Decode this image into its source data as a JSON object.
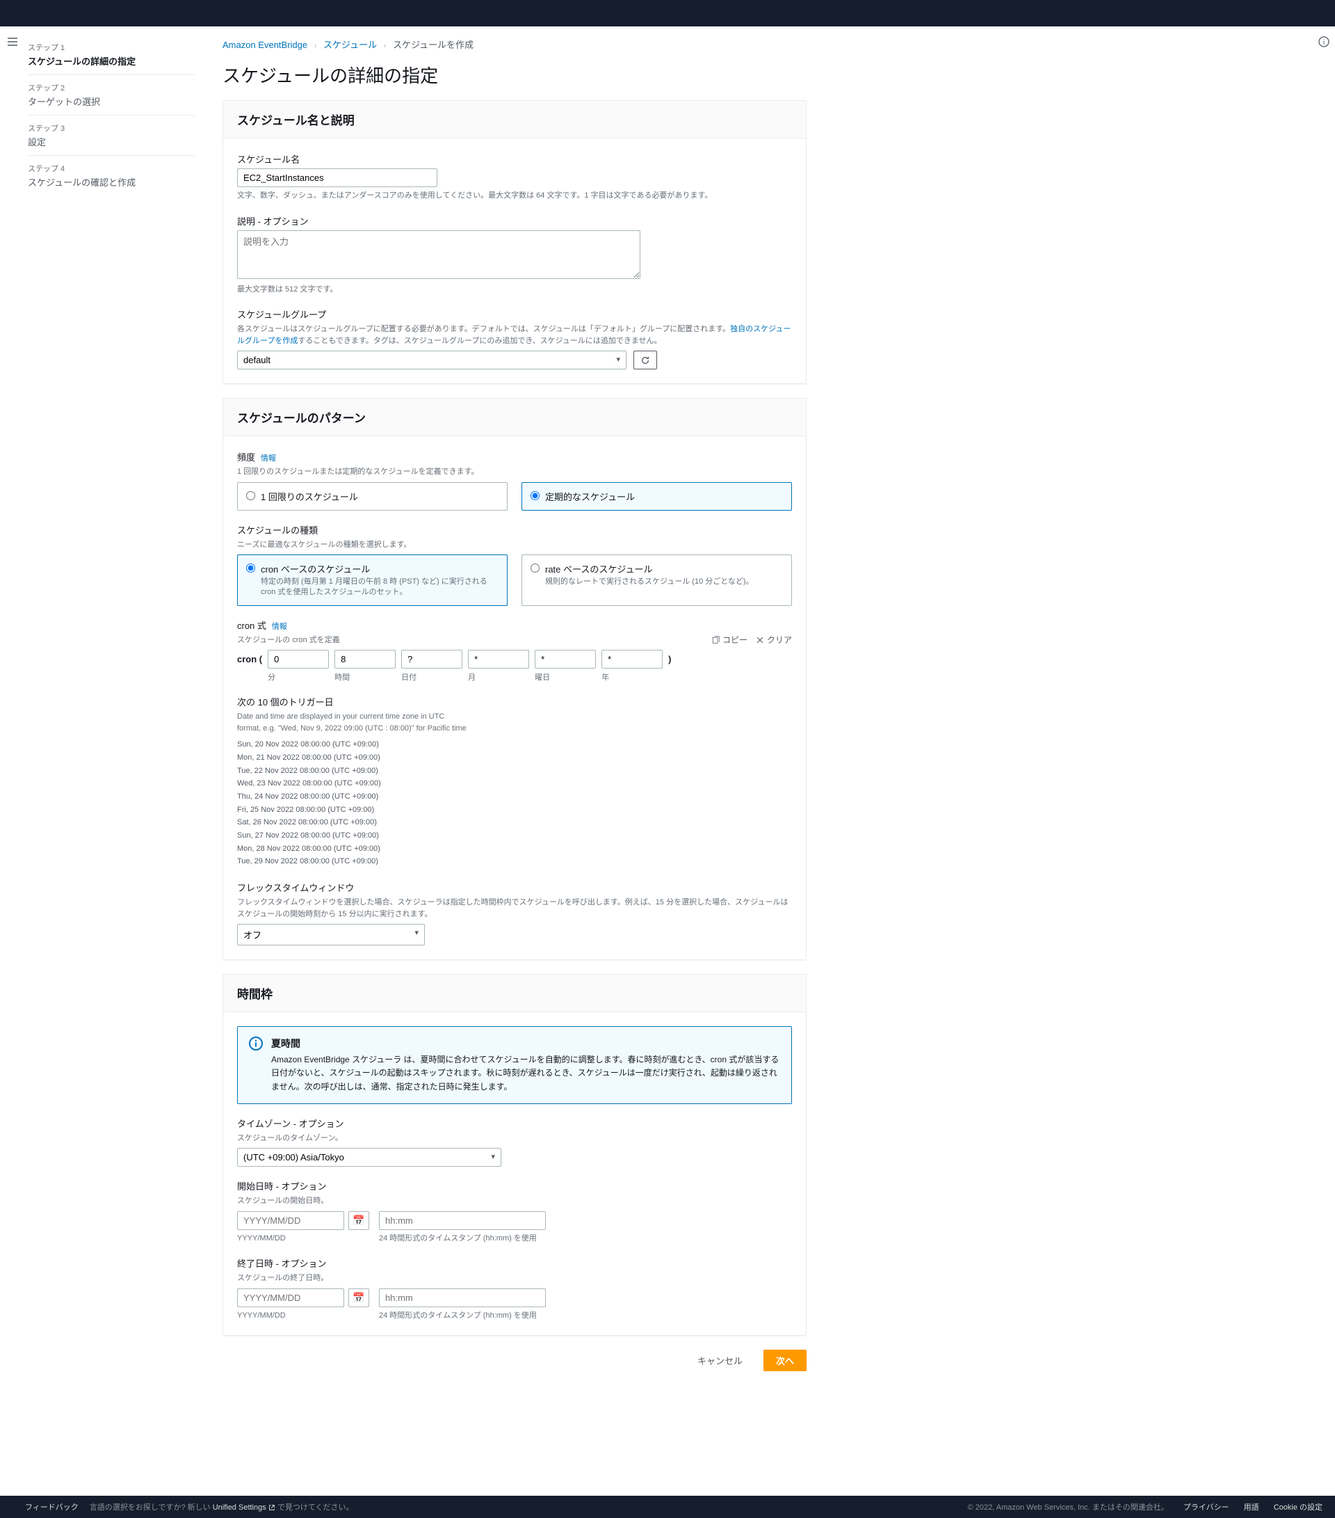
{
  "breadcrumb": {
    "service": "Amazon EventBridge",
    "section": "スケジュール",
    "current": "スケジュールを作成"
  },
  "sidebar": {
    "steps": [
      {
        "label": "ステップ 1",
        "title": "スケジュールの詳細の指定"
      },
      {
        "label": "ステップ 2",
        "title": "ターゲットの選択"
      },
      {
        "label": "ステップ 3",
        "title": "設定"
      },
      {
        "label": "ステップ 4",
        "title": "スケジュールの確認と作成"
      }
    ]
  },
  "page_title": "スケジュールの詳細の指定",
  "panel_name": {
    "title": "スケジュール名と説明",
    "name_label": "スケジュール名",
    "name_value": "EC2_StartInstances",
    "name_hint": "文字、数字、ダッシュ、またはアンダースコアのみを使用してください。最大文字数は 64 文字です。1 字目は文字である必要があります。",
    "desc_label": "説明 - オプション",
    "desc_placeholder": "説明を入力",
    "desc_hint": "最大文字数は 512 文字です。",
    "group_label": "スケジュールグループ",
    "group_hint_pre": "各スケジュールはスケジュールグループに配置する必要があります。デフォルトでは、スケジュールは「デフォルト」グループに配置されます。",
    "group_hint_link": "独自のスケジュールグループを作成",
    "group_hint_post": "することもできます。タグは、スケジュールグループにのみ追加でき、スケジュールには追加できません。",
    "group_value": "default"
  },
  "panel_pattern": {
    "title": "スケジュールのパターン",
    "freq_label": "頻度",
    "info": "情報",
    "freq_hint": "1 回限りのスケジュールまたは定期的なスケジュールを定義できます。",
    "freq_once": "1 回限りのスケジュール",
    "freq_recurring": "定期的なスケジュール",
    "type_label": "スケジュールの種類",
    "type_hint": "ニーズに最適なスケジュールの種類を選択します。",
    "type_cron_title": "cron ベースのスケジュール",
    "type_cron_desc": "特定の時刻 (毎月第 1 月曜日の午前 8 時 (PST) など) に実行される cron 式を使用したスケジュールのセット。",
    "type_rate_title": "rate ベースのスケジュール",
    "type_rate_desc": "規則的なレートで実行されるスケジュール (10 分ごとなど)。",
    "cron_label": "cron 式",
    "cron_sublabel": "スケジュールの cron 式を定義",
    "copy": "コピー",
    "clear": "クリア",
    "cron_open": "cron (",
    "cron_close": ")",
    "cron": {
      "min": {
        "val": "0",
        "lbl": "分"
      },
      "hour": {
        "val": "8",
        "lbl": "時間"
      },
      "dom": {
        "val": "?",
        "lbl": "日付"
      },
      "mon": {
        "val": "*",
        "lbl": "月"
      },
      "dow": {
        "val": "*",
        "lbl": "曜日"
      },
      "year": {
        "val": "*",
        "lbl": "年"
      }
    },
    "next_label": "次の 10 個のトリガー日",
    "next_hint1": "Date and time are displayed in your current time zone in UTC",
    "next_hint2": "format, e.g. \"Wed, Nov 9, 2022 09:00 (UTC : 08:00)\" for Pacific time",
    "triggers": [
      "Sun, 20 Nov 2022 08:00:00 (UTC +09:00)",
      "Mon, 21 Nov 2022 08:00:00 (UTC +09:00)",
      "Tue, 22 Nov 2022 08:00:00 (UTC +09:00)",
      "Wed, 23 Nov 2022 08:00:00 (UTC +09:00)",
      "Thu, 24 Nov 2022 08:00:00 (UTC +09:00)",
      "Fri, 25 Nov 2022 08:00:00 (UTC +09:00)",
      "Sat, 26 Nov 2022 08:00:00 (UTC +09:00)",
      "Sun, 27 Nov 2022 08:00:00 (UTC +09:00)",
      "Mon, 28 Nov 2022 08:00:00 (UTC +09:00)",
      "Tue, 29 Nov 2022 08:00:00 (UTC +09:00)"
    ],
    "flex_label": "フレックスタイムウィンドウ",
    "flex_hint": "フレックスタイムウィンドウを選択した場合、スケジューラは指定した時間枠内でスケジュールを呼び出します。例えば、15 分を選択した場合、スケジュールはスケジュールの開始時刻から 15 分以内に実行されます。",
    "flex_value": "オフ"
  },
  "panel_time": {
    "title": "時間枠",
    "dst_title": "夏時間",
    "dst_text": "Amazon EventBridge スケジューラ は、夏時間に合わせてスケジュールを自動的に調整します。春に時刻が進むとき、cron 式が該当する日付がないと、スケジュールの起動はスキップされます。秋に時刻が遅れるとき、スケジュールは一度だけ実行され、起動は繰り返されません。次の呼び出しは、通常、指定された日時に発生します。",
    "tz_label": "タイムゾーン - オプション",
    "tz_hint": "スケジュールのタイムゾーン。",
    "tz_value": "(UTC +09:00) Asia/Tokyo",
    "start_label": "開始日時 - オプション",
    "start_hint": "スケジュールの開始日時。",
    "end_label": "終了日時 - オプション",
    "end_hint": "スケジュールの終了日時。",
    "date_ph": "YYYY/MM/DD",
    "time_ph": "hh:mm",
    "date_sub": "YYYY/MM/DD",
    "time_sub": "24 時間形式のタイムスタンプ (hh:mm) を使用"
  },
  "buttons": {
    "cancel": "キャンセル",
    "next": "次へ"
  },
  "footer": {
    "feedback": "フィードバック",
    "lang_pre": "言語の選択をお探しですか? 新しい ",
    "lang_link": "Unified Settings",
    "lang_post": " で見つけてください。",
    "copyright": "© 2022, Amazon Web Services, Inc. またはその関連会社。",
    "privacy": "プライバシー",
    "terms": "用語",
    "cookies": "Cookie の設定"
  }
}
